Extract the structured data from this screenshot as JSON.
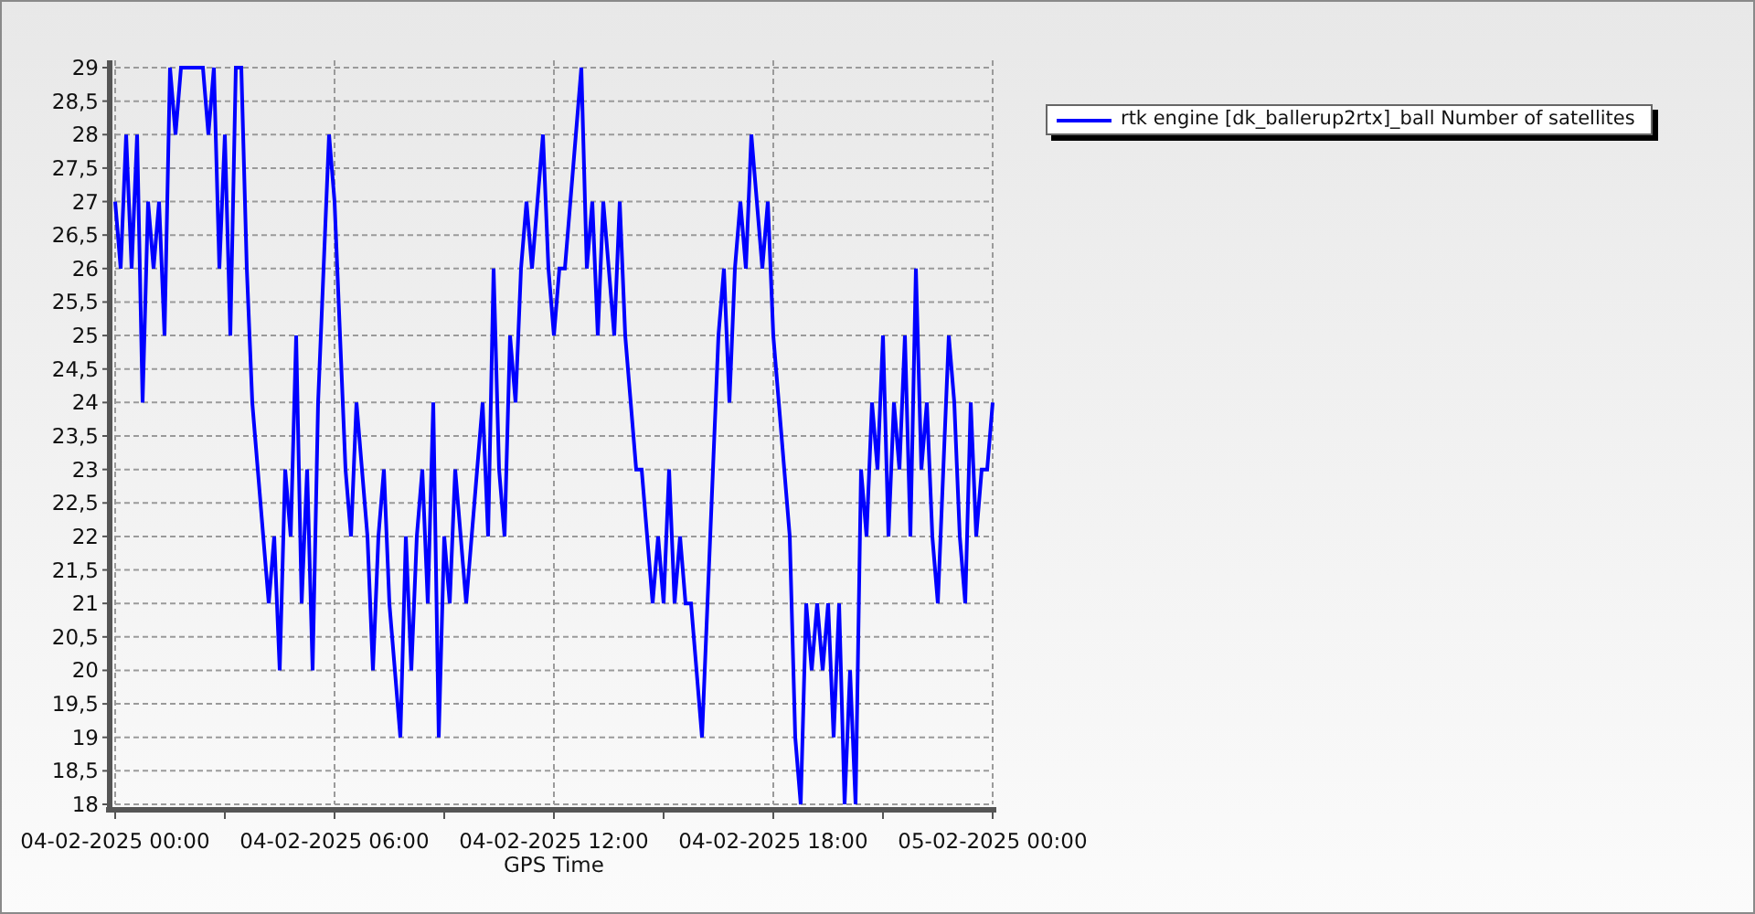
{
  "chart_data": {
    "type": "line",
    "xlabel": "GPS Time",
    "categories": [
      "04-02-2025 00:00",
      null,
      null,
      null,
      null,
      null,
      null,
      null,
      null,
      null,
      null,
      null,
      null,
      null,
      null,
      null,
      null,
      null,
      null,
      null,
      null,
      null,
      null,
      null,
      null,
      null,
      null,
      null,
      null,
      null,
      null,
      null,
      null,
      null,
      null,
      null,
      null,
      null,
      null,
      null,
      "04-02-2025 06:00",
      null,
      null,
      null,
      null,
      null,
      null,
      null,
      null,
      null,
      null,
      null,
      null,
      null,
      null,
      null,
      null,
      null,
      null,
      null,
      null,
      null,
      null,
      null,
      null,
      null,
      null,
      null,
      null,
      null,
      null,
      null,
      null,
      null,
      null,
      null,
      null,
      null,
      null,
      null,
      "04-02-2025 12:00",
      null,
      null,
      null,
      null,
      null,
      null,
      null,
      null,
      null,
      null,
      null,
      null,
      null,
      null,
      null,
      null,
      null,
      null,
      null,
      null,
      null,
      null,
      null,
      null,
      null,
      null,
      null,
      null,
      null,
      null,
      null,
      null,
      null,
      null,
      null,
      null,
      null,
      null,
      null,
      "04-02-2025 18:00",
      null,
      null,
      null,
      null,
      null,
      null,
      null,
      null,
      null,
      null,
      null,
      null,
      null,
      null,
      null,
      null,
      null,
      null,
      null,
      null,
      null,
      null,
      null,
      null,
      null,
      null,
      null,
      null,
      null,
      null,
      null,
      null,
      null,
      null,
      null,
      null,
      null,
      null,
      null,
      "05-02-2025 00:00"
    ],
    "series": [
      {
        "name": "rtk engine [dk_ballerup2rtx]_ball Number of satellites",
        "color": "#0000ff",
        "values": [
          27,
          26,
          28,
          26,
          28,
          24,
          27,
          26,
          27,
          25,
          29,
          28,
          29,
          29,
          29,
          29,
          29,
          28,
          29,
          26,
          28,
          25,
          29,
          29,
          26,
          24,
          23,
          22,
          21,
          22,
          20,
          23,
          22,
          25,
          21,
          23,
          20,
          24,
          26,
          28,
          27,
          25,
          23,
          22,
          24,
          23,
          22,
          20,
          22,
          23,
          21,
          20,
          19,
          22,
          20,
          22,
          23,
          21,
          24,
          19,
          22,
          21,
          23,
          22,
          21,
          22,
          23,
          24,
          22,
          26,
          23,
          22,
          25,
          24,
          26,
          27,
          26,
          27,
          28,
          26,
          25,
          26,
          26,
          27,
          28,
          29,
          26,
          27,
          25,
          27,
          26,
          25,
          27,
          25,
          24,
          23,
          23,
          22,
          21,
          22,
          21,
          23,
          21,
          22,
          21,
          21,
          20,
          19,
          21,
          23,
          25,
          26,
          24,
          26,
          27,
          26,
          28,
          27,
          26,
          27,
          25,
          24,
          23,
          22,
          19,
          18,
          21,
          20,
          21,
          20,
          21,
          19,
          21,
          18,
          20,
          18,
          23,
          22,
          24,
          23,
          25,
          22,
          24,
          23,
          25,
          22,
          26,
          23,
          24,
          22,
          21,
          23,
          25,
          24,
          22,
          21,
          24,
          22,
          23,
          23,
          24
        ]
      }
    ],
    "grid": true,
    "ylim": [
      18,
      29
    ],
    "yticks": [
      {
        "value": 18,
        "label": "18"
      },
      {
        "value": 18.5,
        "label": "18,5"
      },
      {
        "value": 19,
        "label": "19"
      },
      {
        "value": 19.5,
        "label": "19,5"
      },
      {
        "value": 20,
        "label": "20"
      },
      {
        "value": 20.5,
        "label": "20,5"
      },
      {
        "value": 21,
        "label": "21"
      },
      {
        "value": 21.5,
        "label": "21,5"
      },
      {
        "value": 22,
        "label": "22"
      },
      {
        "value": 22.5,
        "label": "22,5"
      },
      {
        "value": 23,
        "label": "23"
      },
      {
        "value": 23.5,
        "label": "23,5"
      },
      {
        "value": 24,
        "label": "24"
      },
      {
        "value": 24.5,
        "label": "24,5"
      },
      {
        "value": 25,
        "label": "25"
      },
      {
        "value": 25.5,
        "label": "25,5"
      },
      {
        "value": 26,
        "label": "26"
      },
      {
        "value": 26.5,
        "label": "26,5"
      },
      {
        "value": 27,
        "label": "27"
      },
      {
        "value": 27.5,
        "label": "27,5"
      },
      {
        "value": 28,
        "label": "28"
      },
      {
        "value": 28.5,
        "label": "28,5"
      },
      {
        "value": 29,
        "label": "29"
      }
    ]
  }
}
